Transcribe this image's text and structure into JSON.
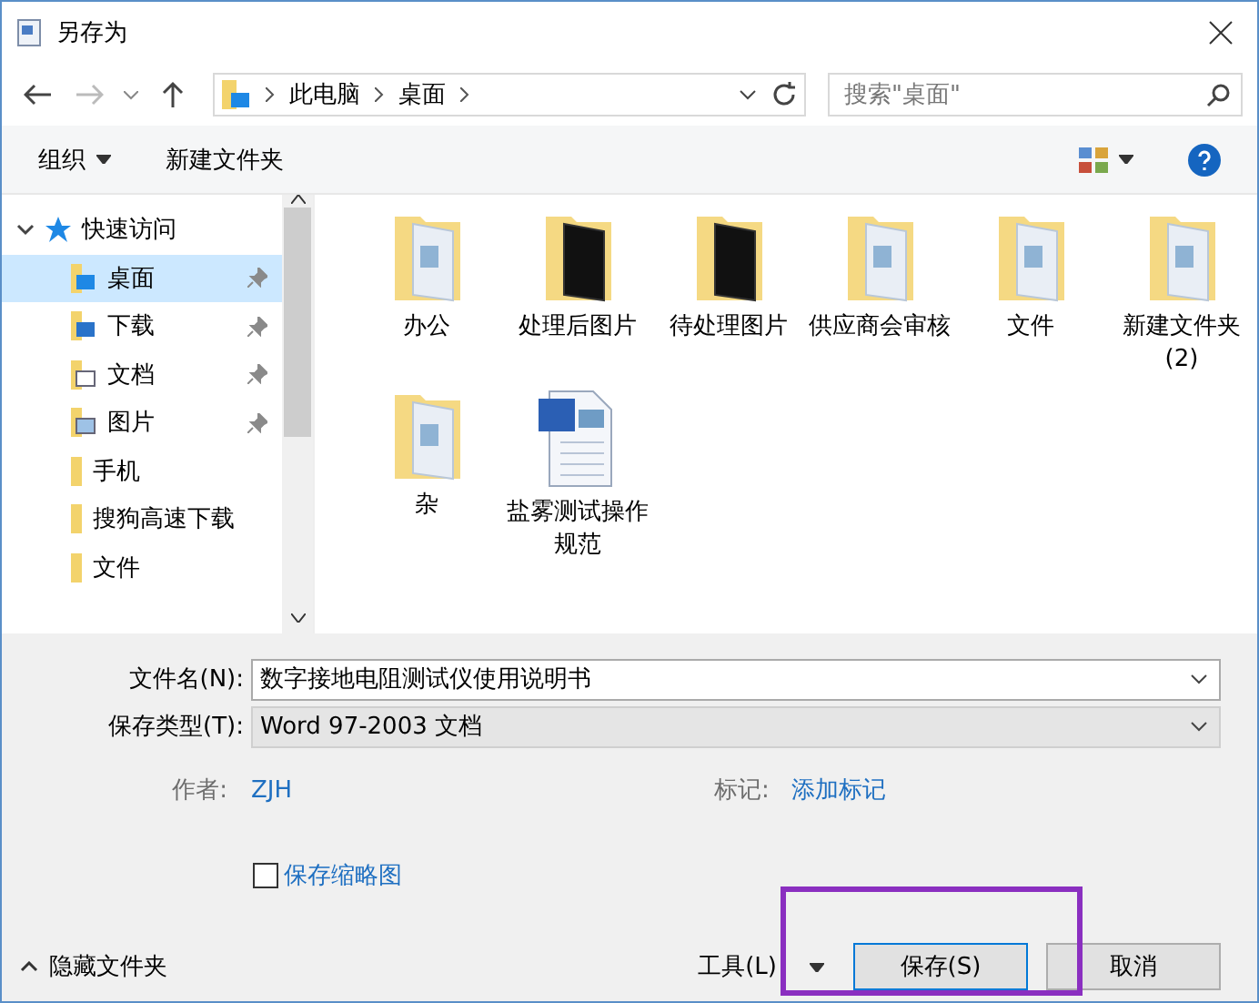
{
  "window": {
    "title": "另存为"
  },
  "address": {
    "crumbs": [
      "此电脑",
      "桌面"
    ],
    "search_placeholder": "搜索\"桌面\""
  },
  "toolbar": {
    "organize": "组织",
    "new_folder": "新建文件夹"
  },
  "sidebar": {
    "items": [
      {
        "label": "快速访问",
        "expanded": true,
        "children": [
          {
            "label": "桌面",
            "kind": "desktop",
            "pinned": true,
            "selected": true
          },
          {
            "label": "下载",
            "kind": "download",
            "pinned": true,
            "selected": false
          },
          {
            "label": "文档",
            "kind": "document",
            "pinned": true,
            "selected": false
          },
          {
            "label": "图片",
            "kind": "picture",
            "pinned": true,
            "selected": false
          },
          {
            "label": "手机",
            "kind": "folder",
            "pinned": false,
            "selected": false
          },
          {
            "label": "搜狗高速下载",
            "kind": "folder",
            "pinned": false,
            "selected": false
          },
          {
            "label": "文件",
            "kind": "folder",
            "pinned": false,
            "selected": false
          }
        ]
      }
    ]
  },
  "files": [
    {
      "name": "办公",
      "kind": "folder"
    },
    {
      "name": "处理后图片",
      "kind": "dark-folder"
    },
    {
      "name": "待处理图片",
      "kind": "dark-folder"
    },
    {
      "name": "供应商会审核",
      "kind": "folder"
    },
    {
      "name": "文件",
      "kind": "folder"
    },
    {
      "name": "新建文件夹 (2)",
      "kind": "folder"
    },
    {
      "name": "杂",
      "kind": "folder"
    },
    {
      "name": "盐雾测试操作规范",
      "kind": "word"
    }
  ],
  "form": {
    "filename_label": "文件名(N):",
    "filename": "数字接地电阻测试仪使用说明书",
    "type_label": "保存类型(T):",
    "type": "Word 97-2003 文档",
    "author_label": "作者:",
    "author": "ZJH",
    "tags_label": "标记:",
    "tags": "添加标记",
    "thumbnail_label": "保存缩略图",
    "thumbnail_checked": false
  },
  "footer": {
    "hide_folders": "隐藏文件夹",
    "tools": "工具(L)",
    "save": "保存(S)",
    "cancel": "取消"
  }
}
